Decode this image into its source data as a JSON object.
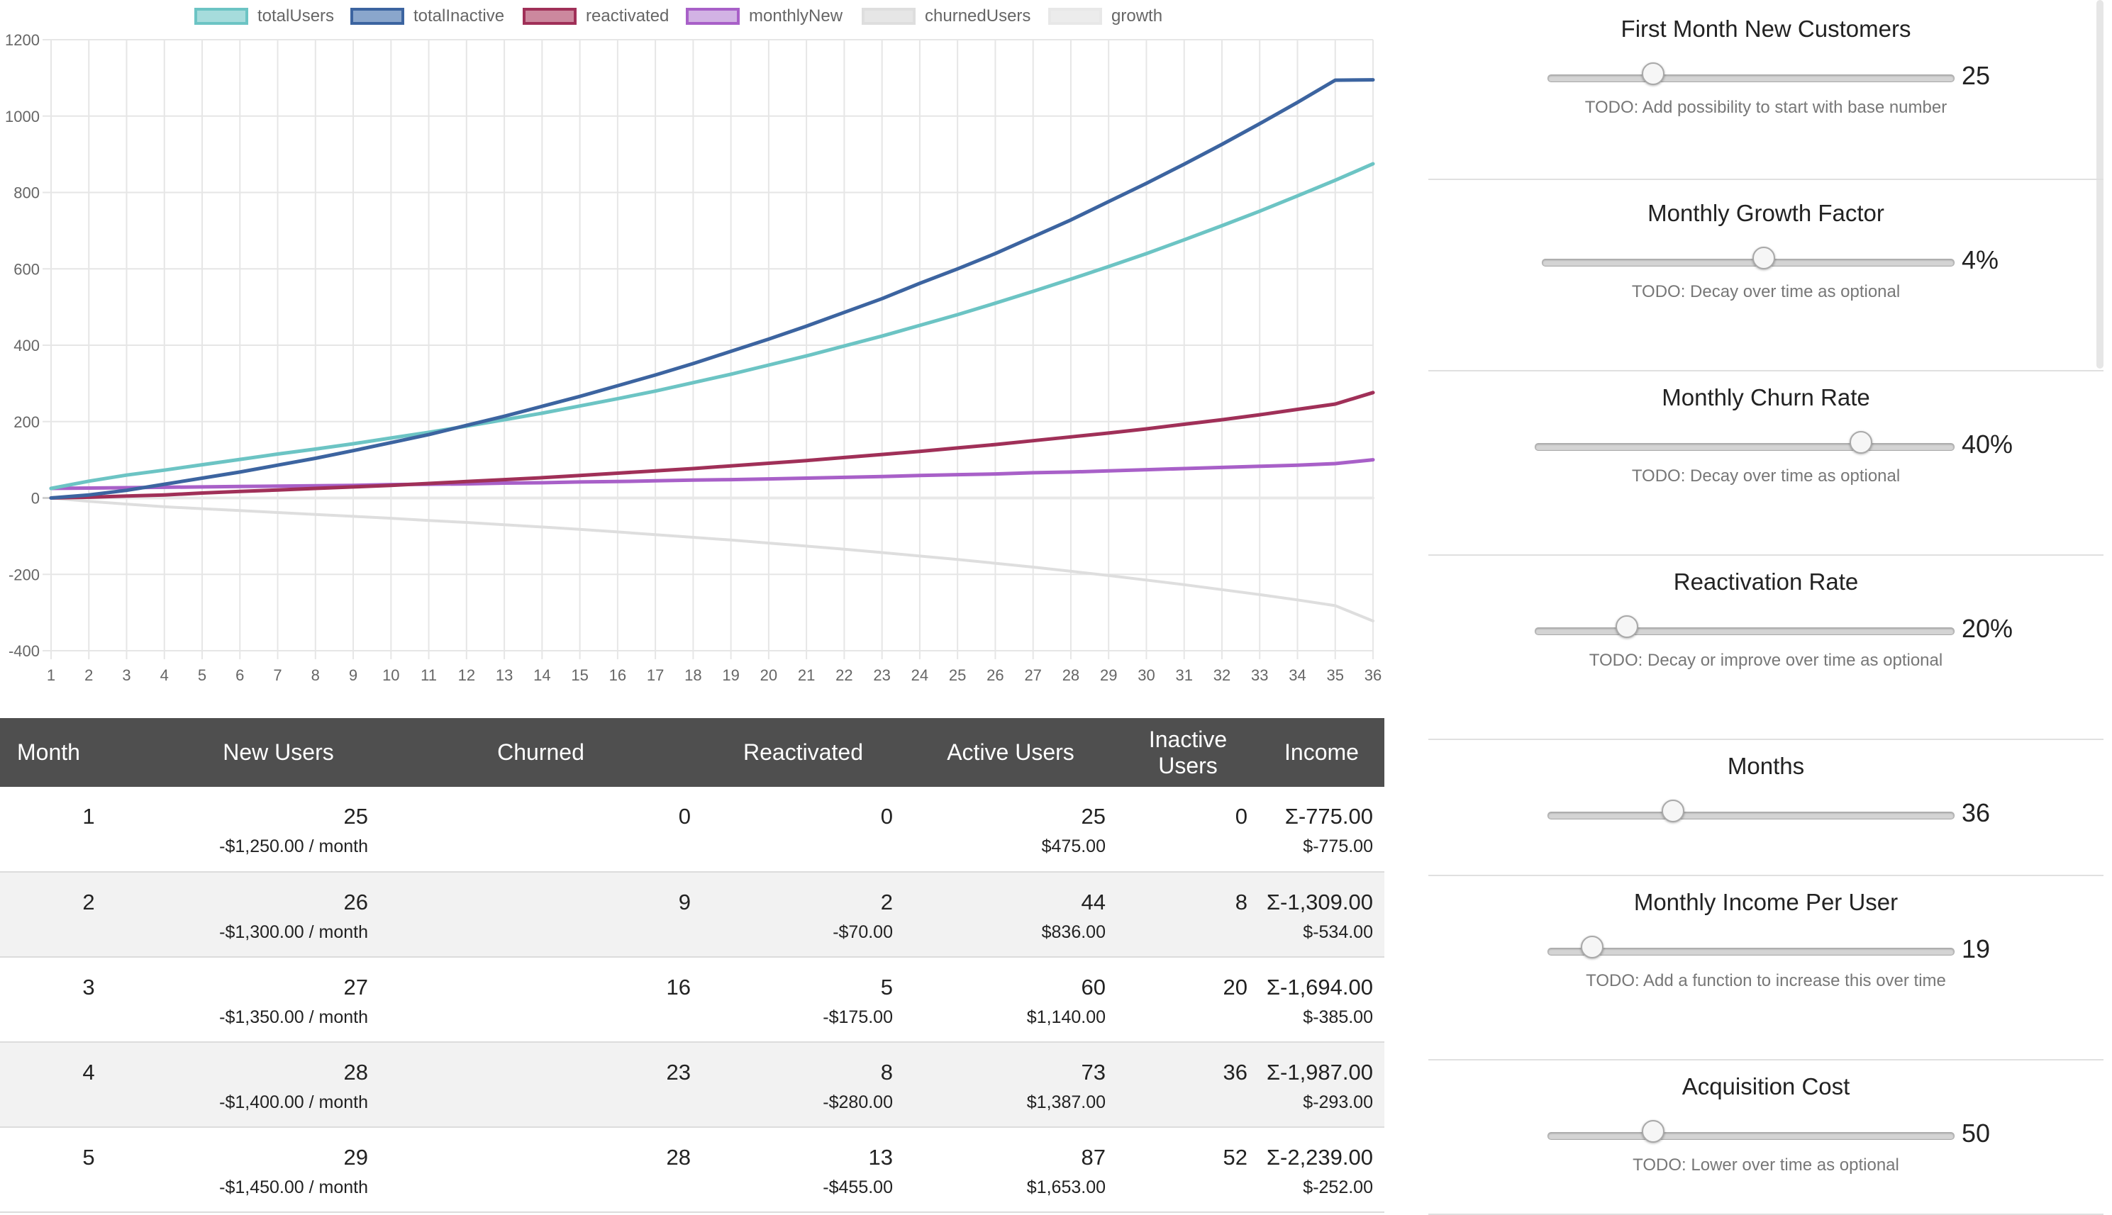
{
  "chart_data": {
    "type": "line",
    "x": [
      1,
      2,
      3,
      4,
      5,
      6,
      7,
      8,
      9,
      10,
      11,
      12,
      13,
      14,
      15,
      16,
      17,
      18,
      19,
      20,
      21,
      22,
      23,
      24,
      25,
      26,
      27,
      28,
      29,
      30,
      31,
      32,
      33,
      34,
      35,
      36
    ],
    "ylim": [
      -400,
      1200
    ],
    "yticks": [
      1200,
      1000,
      800,
      600,
      400,
      200,
      0,
      -200,
      -400
    ],
    "grid": true,
    "legend_position": "top",
    "series": [
      {
        "name": "totalUsers",
        "color": "#6cc4c4",
        "fill": "#a6dcdc",
        "values": [
          25,
          44,
          60,
          73,
          87,
          101,
          115,
          128,
          142,
          157,
          172,
          188,
          205,
          222,
          241,
          260,
          280,
          302,
          324,
          348,
          372,
          398,
          424,
          452,
          480,
          510,
          541,
          573,
          606,
          640,
          676,
          713,
          751,
          791,
          832,
          875
        ]
      },
      {
        "name": "totalInactive",
        "color": "#3c64a0",
        "fill": "#8aa6cc",
        "values": [
          0,
          8,
          20,
          36,
          52,
          68,
          86,
          104,
          124,
          145,
          166,
          190,
          214,
          240,
          266,
          294,
          322,
          352,
          384,
          416,
          450,
          486,
          522,
          562,
          600,
          640,
          684,
          728,
          776,
          824,
          874,
          926,
          980,
          1036,
          1094,
          1095
        ]
      },
      {
        "name": "reactivated",
        "color": "#a03058",
        "fill": "#cc889e",
        "values": [
          0,
          2,
          5,
          8,
          13,
          17,
          21,
          25,
          29,
          33,
          38,
          43,
          48,
          53,
          59,
          65,
          71,
          77,
          84,
          91,
          98,
          106,
          114,
          122,
          131,
          140,
          150,
          160,
          170,
          181,
          193,
          205,
          218,
          232,
          246,
          276
        ]
      },
      {
        "name": "monthlyNew",
        "color": "#a860c8",
        "fill": "#d2b2e4",
        "values": [
          25,
          26,
          27,
          28,
          29,
          30,
          31,
          32,
          33,
          35,
          36,
          37,
          39,
          40,
          42,
          43,
          45,
          47,
          48,
          50,
          52,
          54,
          56,
          59,
          61,
          63,
          66,
          68,
          71,
          74,
          77,
          80,
          83,
          86,
          90,
          100
        ]
      },
      {
        "name": "churnedUsers",
        "color": "#dedede",
        "fill": "#e6e6e6",
        "values": [
          0,
          -9,
          -16,
          -23,
          -28,
          -33,
          -38,
          -43,
          -48,
          -53,
          -59,
          -64,
          -70,
          -76,
          -82,
          -89,
          -96,
          -103,
          -110,
          -118,
          -126,
          -134,
          -143,
          -152,
          -161,
          -171,
          -181,
          -192,
          -203,
          -215,
          -227,
          -240,
          -253,
          -267,
          -282,
          -322
        ]
      },
      {
        "name": "growth",
        "color": "#e8e8e8",
        "fill": "#ececec",
        "values": [
          0,
          0,
          0,
          0,
          0,
          0,
          0,
          0,
          0,
          0,
          0,
          0,
          0,
          0,
          0,
          0,
          0,
          0,
          0,
          0,
          0,
          0,
          0,
          0,
          0,
          0,
          0,
          0,
          0,
          0,
          0,
          0,
          0,
          0,
          0,
          0
        ]
      }
    ]
  },
  "table": {
    "headers": {
      "month": "Month",
      "new_users": "New Users",
      "churned": "Churned",
      "reactivated": "Reactivated",
      "active_users": "Active Users",
      "inactive_users": "Inactive Users",
      "income": "Income"
    },
    "rows": [
      {
        "month": "1",
        "new_users": "25",
        "new_users_cost": "-$1,250.00 / month",
        "churned": "0",
        "reactivated": "0",
        "reactivated_value": "",
        "active_users": "25",
        "active_value": "$475.00",
        "inactive_users": "0",
        "income_total": "Σ-775.00",
        "income_month": "$-775.00"
      },
      {
        "month": "2",
        "new_users": "26",
        "new_users_cost": "-$1,300.00 / month",
        "churned": "9",
        "reactivated": "2",
        "reactivated_value": "-$70.00",
        "active_users": "44",
        "active_value": "$836.00",
        "inactive_users": "8",
        "income_total": "Σ-1,309.00",
        "income_month": "$-534.00"
      },
      {
        "month": "3",
        "new_users": "27",
        "new_users_cost": "-$1,350.00 / month",
        "churned": "16",
        "reactivated": "5",
        "reactivated_value": "-$175.00",
        "active_users": "60",
        "active_value": "$1,140.00",
        "inactive_users": "20",
        "income_total": "Σ-1,694.00",
        "income_month": "$-385.00"
      },
      {
        "month": "4",
        "new_users": "28",
        "new_users_cost": "-$1,400.00 / month",
        "churned": "23",
        "reactivated": "8",
        "reactivated_value": "-$280.00",
        "active_users": "73",
        "active_value": "$1,387.00",
        "inactive_users": "36",
        "income_total": "Σ-1,987.00",
        "income_month": "$-293.00"
      },
      {
        "month": "5",
        "new_users": "29",
        "new_users_cost": "-$1,450.00 / month",
        "churned": "28",
        "reactivated": "13",
        "reactivated_value": "-$455.00",
        "active_users": "87",
        "active_value": "$1,653.00",
        "inactive_users": "52",
        "income_total": "Σ-2,239.00",
        "income_month": "$-252.00"
      }
    ]
  },
  "settings": [
    {
      "id": "first-month-new-customers",
      "title": "First Month New Customers",
      "value": "25",
      "fraction": 0.26,
      "note": "TODO: Add possibility to start with base number"
    },
    {
      "id": "monthly-growth-factor",
      "title": "Monthly Growth Factor",
      "value": "4%",
      "fraction": 0.54,
      "note": "TODO: Decay over time as optional"
    },
    {
      "id": "monthly-churn-rate",
      "title": "Monthly Churn Rate",
      "value": "40%",
      "fraction": 0.78,
      "note": "TODO: Decay over time as optional"
    },
    {
      "id": "reactivation-rate",
      "title": "Reactivation Rate",
      "value": "20%",
      "fraction": 0.22,
      "note": "TODO: Decay or improve over time as optional"
    },
    {
      "id": "months",
      "title": "Months",
      "value": "36",
      "fraction": 0.31,
      "note": ""
    },
    {
      "id": "monthly-income-per-user",
      "title": "Monthly Income Per User",
      "value": "19",
      "fraction": 0.11,
      "note": "TODO: Add a function to increase this over time"
    },
    {
      "id": "acquisition-cost",
      "title": "Acquisition Cost",
      "value": "50",
      "fraction": 0.26,
      "note": "TODO: Lower over time as optional"
    }
  ]
}
